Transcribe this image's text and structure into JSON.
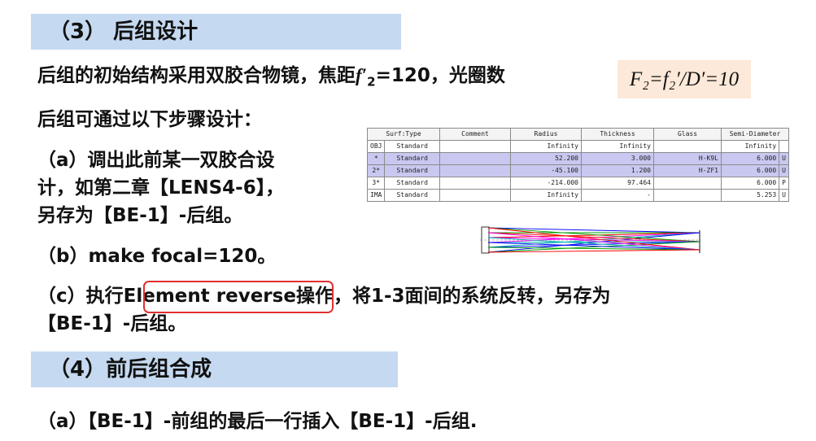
{
  "section3": {
    "title": "（3） 后组设计"
  },
  "p1": {
    "prefix": "后组的初始结构采用双胶合物镜，焦距",
    "symbol": "f′",
    "subscript": "2",
    "suffix": "=120，光圈数"
  },
  "formula": {
    "text": "F₂=f₂′/D′=10"
  },
  "p2": {
    "text": "后组可通过以下步骤设计："
  },
  "step_a": {
    "line1": "（a）调出此前某一双胶合设",
    "line2": "计，如第二章【LENS4-6】，",
    "line3": "另存为【BE-1】-后组。"
  },
  "step_b": {
    "text": "（b）make focal=120。"
  },
  "step_c": {
    "prefix": "（c）执行",
    "highlight": "Element reverse",
    "suffix": "操作，将1-3面间的系统反转，另存为",
    "line2": "【BE-1】-后组。"
  },
  "section4": {
    "title": "（4）前后组合成"
  },
  "step4a": {
    "text": "（a）【BE-1】-前组的最后一行插入【BE-1】-后组."
  },
  "lens_table": {
    "headers": [
      "Surf:Type",
      "Comment",
      "Radius",
      "Thickness",
      "Glass",
      "Semi-Diameter"
    ],
    "rows": [
      {
        "surf": "OBJ",
        "type": "Standard",
        "comment": "",
        "radius": "Infinity",
        "thickness": "Infinity",
        "glass": "",
        "semi": "Infinity",
        "flag": ""
      },
      {
        "surf": "*",
        "type": "Standard",
        "comment": "",
        "radius": "52.200",
        "thickness": "3.000",
        "glass": "H-K9L",
        "semi": "6.000",
        "flag": "U"
      },
      {
        "surf": "2*",
        "type": "Standard",
        "comment": "",
        "radius": "-45.100",
        "thickness": "1.200",
        "glass": "H-ZF1",
        "semi": "6.000",
        "flag": "U"
      },
      {
        "surf": "3*",
        "type": "Standard",
        "comment": "",
        "radius": "-214.000",
        "thickness": "97.464",
        "glass": "",
        "semi": "6.000",
        "flag": "P"
      },
      {
        "surf": "IMA",
        "type": "Standard",
        "comment": "",
        "radius": "Infinity",
        "thickness": "-",
        "glass": "",
        "semi": "5.253",
        "flag": "U"
      }
    ]
  },
  "colors": {
    "band": "#c5d9f1",
    "formula_bg": "#fde9d9",
    "highlight_border": "#e03030",
    "selected_row": "#c8c8f0"
  },
  "ray_diagram": {
    "icon": "lens-ray-trace-icon",
    "ray_colors": [
      "#0000ff",
      "#00a000",
      "#ff0000",
      "#ff00ff",
      "#00b0b0"
    ]
  }
}
